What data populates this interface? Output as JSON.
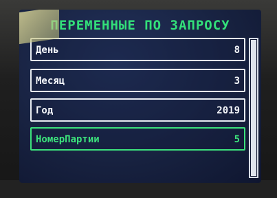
{
  "screen": {
    "title": "ПЕРЕМЕННЫЕ ПО ЗАПРОСУ"
  },
  "rows": [
    {
      "label": "День",
      "value": "8"
    },
    {
      "label": "Месяц",
      "value": "3"
    },
    {
      "label": "Год",
      "value": "2019"
    },
    {
      "label": "НомерПартии",
      "value": "5"
    }
  ],
  "selected_row_index": 3,
  "scroll": {
    "position_fraction": 0.0,
    "visible_fraction": 1.0
  },
  "colors": {
    "background": "#17213f",
    "title": "#33e07a",
    "row_border": "#e8ecf2",
    "selected": "#3ce27c",
    "text": "#f4f6fa"
  }
}
